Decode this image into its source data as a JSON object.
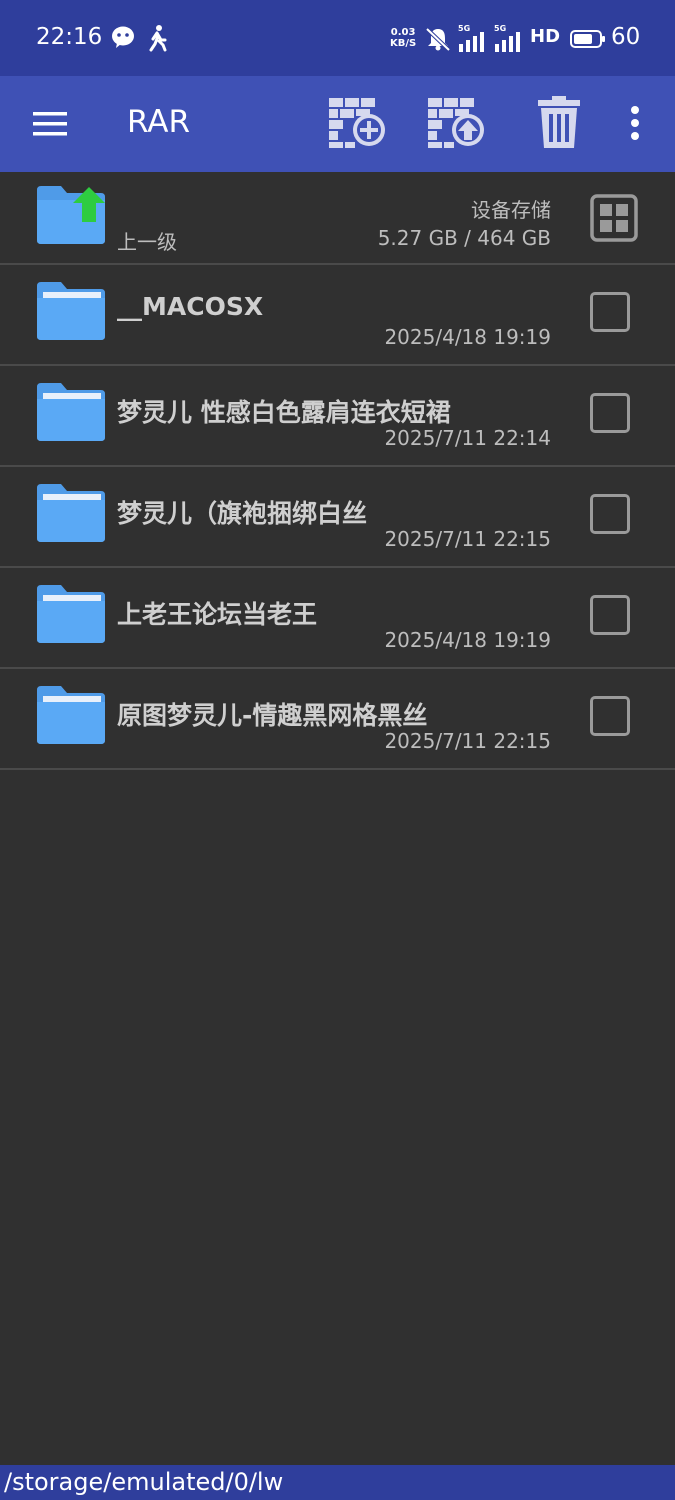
{
  "status_bar": {
    "time": "22:16",
    "net_speed_value": "0.03",
    "net_speed_unit": "KB/S",
    "network_type_1": "5G",
    "network_type_2": "5G",
    "hd_label": "HD",
    "battery_level": "60",
    "icons": [
      "wechat-icon",
      "walk-icon",
      "mute-bell-icon",
      "signal-icon",
      "signal-icon",
      "battery-icon"
    ]
  },
  "toolbar": {
    "title": "RAR",
    "icons": [
      "menu-icon",
      "archive-add-icon",
      "archive-extract-icon",
      "trash-icon",
      "more-vert-icon"
    ]
  },
  "parent_row": {
    "label": "上一级",
    "storage_label": "设备存储",
    "storage_size": "5.27 GB / 464 GB"
  },
  "items": [
    {
      "name": "__MACOSX",
      "date": "2025/4/18 19:19"
    },
    {
      "name": "梦灵儿 性感白色露肩连衣短裙",
      "date": "2025/7/11 22:14"
    },
    {
      "name": "梦灵儿（旗袍捆绑白丝",
      "date": "2025/7/11 22:15"
    },
    {
      "name": "上老王论坛当老王",
      "date": "2025/4/18 19:19"
    },
    {
      "name": "原图梦灵儿-情趣黑网格黑丝",
      "date": "2025/7/11 22:15"
    }
  ],
  "path": "/storage/emulated/0/lw",
  "colors": {
    "status_bar": "#2f3e9c",
    "toolbar": "#3f51b5",
    "background": "#303030",
    "folder": "#5aa9f5",
    "up_arrow": "#2ecc40"
  }
}
